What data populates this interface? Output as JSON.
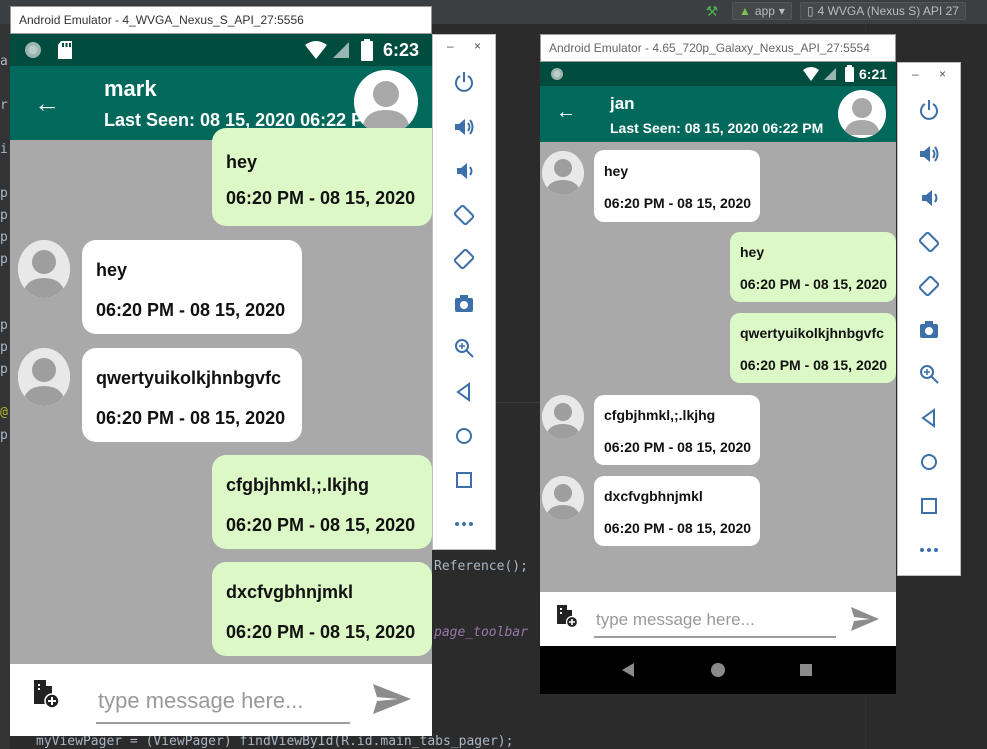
{
  "ide": {
    "run_config": "app",
    "device_selector": "4  WVGA (Nexus S) API 27",
    "code_reference": "Reference();",
    "code_toolbar": "page_toolbar",
    "code_bottom": "myViewPager = (ViewPager) findViewById(R.id.main_tabs_pager);",
    "gutter_chars": [
      "a",
      "r",
      "i",
      "p",
      "p",
      "p",
      "p",
      "p",
      "p",
      "p",
      "@",
      "p"
    ]
  },
  "emulator_left": {
    "window_title": "Android Emulator - 4_WVGA_Nexus_S_API_27:5556",
    "status_time": "6:23",
    "chat_name": "mark",
    "last_seen": "Last Seen: 08 15, 2020 06:22 PM",
    "messages": [
      {
        "type": "sent",
        "text": "hey",
        "time": "06:20 PM - 08 15, 2020"
      },
      {
        "type": "recv",
        "text": "hey",
        "time": "06:20 PM - 08 15, 2020"
      },
      {
        "type": "recv",
        "text": "qwertyuikolkjhnbgvfc",
        "time": "06:20 PM - 08 15, 2020"
      },
      {
        "type": "sent",
        "text": "cfgbjhmkl,;.lkjhg",
        "time": "06:20 PM - 08 15, 2020"
      },
      {
        "type": "sent",
        "text": "dxcfvgbhnjmkl",
        "time": "06:20 PM - 08 15, 2020"
      }
    ],
    "input_placeholder": "type message here..."
  },
  "emulator_right": {
    "window_title": "Android Emulator - 4.65_720p_Galaxy_Nexus_API_27:5554",
    "status_time": "6:21",
    "chat_name": "jan",
    "last_seen": "Last Seen: 08 15, 2020 06:22 PM",
    "messages": [
      {
        "type": "recv",
        "text": "hey",
        "time": "06:20 PM - 08 15, 2020"
      },
      {
        "type": "sent",
        "text": "hey",
        "time": "06:20 PM - 08 15, 2020"
      },
      {
        "type": "sent",
        "text": "qwertyuikolkjhnbgvfc",
        "time": "06:20 PM - 08 15, 2020"
      },
      {
        "type": "recv",
        "text": "cfgbjhmkl,;.lkjhg",
        "time": "06:20 PM - 08 15, 2020"
      },
      {
        "type": "recv",
        "text": "dxcfvgbhnjmkl",
        "time": "06:20 PM - 08 15, 2020"
      }
    ],
    "input_placeholder": "type message here..."
  },
  "side_panel": {
    "minimize": "–",
    "close": "×",
    "controls": [
      "power-icon",
      "volume-up-icon",
      "volume-down-icon",
      "rotate-left-icon",
      "rotate-right-icon",
      "camera-icon",
      "zoom-icon",
      "back-icon",
      "home-icon",
      "overview-icon",
      "more-icon"
    ]
  },
  "colors": {
    "toolbar": "#00695c",
    "status_bar": "#004d40",
    "sent_bubble": "#dcf8c6",
    "recv_bubble": "#ffffff",
    "chat_background": "#a9a9a9",
    "emulator_icon": "#3d6fa8"
  }
}
